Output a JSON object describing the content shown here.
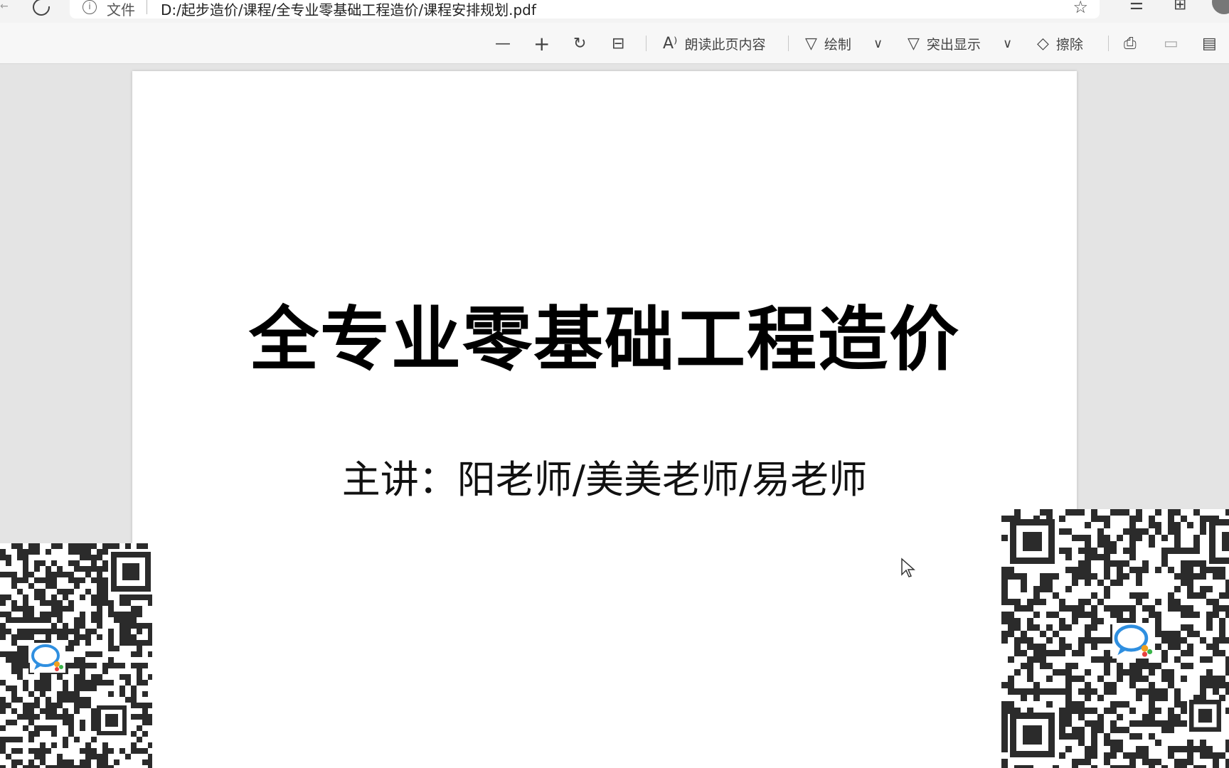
{
  "address_bar": {
    "file_label": "文件",
    "url": "D:/起步造价/课程/全专业零基础工程造价/课程安排规划.pdf"
  },
  "toolbar": {
    "zoom_out_icon": "minus-icon",
    "zoom_in_icon": "plus-icon",
    "rotate_icon": "rotate-icon",
    "fit_icon": "fit-page-icon",
    "read_aloud_label": "朗读此页内容",
    "draw_label": "绘制",
    "highlight_label": "突出显示",
    "erase_label": "擦除"
  },
  "document": {
    "title": "全专业零基础工程造价",
    "subtitle": "主讲：阳老师/美美老师/易老师"
  },
  "colors": {
    "page_background": "#ffffff",
    "viewer_background": "#e4e4e4",
    "toolbar_background": "#f7f7f7",
    "qr_dark": "#2b2b2b"
  }
}
